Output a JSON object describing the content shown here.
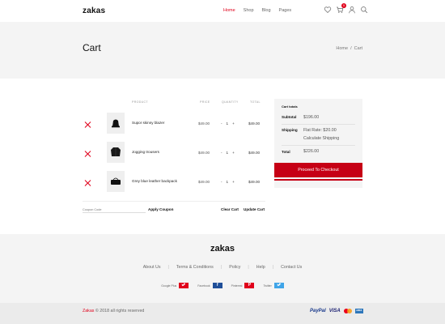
{
  "header": {
    "logo": "zakas",
    "nav": [
      {
        "label": "Home",
        "active": true
      },
      {
        "label": "Shop",
        "active": false
      },
      {
        "label": "Blog",
        "active": false
      },
      {
        "label": "Pages",
        "active": false
      }
    ],
    "cart_count": "0",
    "icons": [
      "heart-icon",
      "cart-icon",
      "user-icon",
      "search-icon"
    ]
  },
  "banner": {
    "title": "Cart",
    "breadcrumb": [
      "Home",
      "/",
      "Cart"
    ]
  },
  "cart": {
    "headers": {
      "product": "PRODUCT",
      "price": "PRICE",
      "quantity": "QUANTITY",
      "total": "TOTAL"
    },
    "items": [
      {
        "name": "Supor skinny blazer",
        "price": "$49.00",
        "qty": "1",
        "total": "$49.00",
        "thumb": "hat-icon"
      },
      {
        "name": "Jogging trousers",
        "price": "$49.00",
        "qty": "1",
        "total": "$49.00",
        "thumb": "jacket-icon"
      },
      {
        "name": "Grey blue leather backpack",
        "price": "$49.00",
        "qty": "1",
        "total": "$49.00",
        "thumb": "bag-icon"
      }
    ],
    "qty_minus": "-",
    "qty_plus": "+",
    "coupon_placeholder": "Coupon Code",
    "apply_coupon": "Apply Coupon",
    "clear_cart": "Clear Cart",
    "update_cart": "Update Cart"
  },
  "totals": {
    "title": "Cart totals",
    "subtotal_label": "Subtotal",
    "subtotal_value": "$196.00",
    "shipping_label": "Shipping",
    "shipping_value": "Flat Rate: $20.00",
    "shipping_calc": "Calculate Shipping",
    "total_label": "Total",
    "total_value": "$226.00",
    "checkout": "Proceed To Checkout"
  },
  "footer": {
    "logo": "zakas",
    "links": [
      "About Us",
      "Terms & Conditions",
      "Policy",
      "Help",
      "Contact Us"
    ],
    "socials": [
      {
        "label": "Google Plus",
        "icon": "twitter-icon",
        "glyph": "🐦",
        "color": "#e0001b"
      },
      {
        "label": "Facebook",
        "icon": "facebook-icon",
        "glyph": "f",
        "color": "#1f4f99"
      },
      {
        "label": "Pinterest",
        "icon": "pinterest-icon",
        "glyph": "P",
        "color": "#e0001b"
      },
      {
        "label": "Twitter",
        "icon": "twitter-icon",
        "glyph": "🐦",
        "color": "#3fa4e8"
      }
    ],
    "copyright_brand": "Zakas",
    "copyright_text": " © 2018 all rights reserved",
    "payments": [
      "PayPal",
      "VISA",
      "mastercard",
      "AMEX"
    ]
  },
  "colors": {
    "accent": "#e0001b",
    "checkout": "#c60015"
  }
}
